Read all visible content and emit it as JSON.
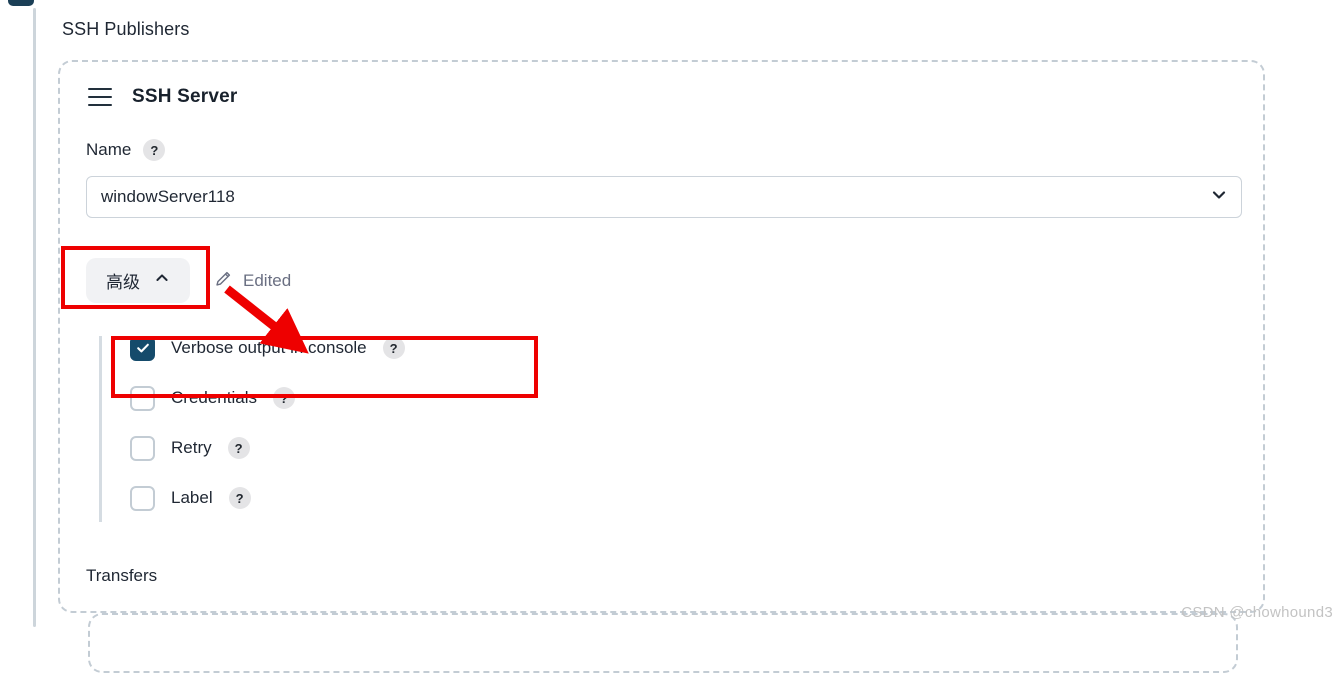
{
  "page": {
    "section_title": "SSH Publishers",
    "watermark": "CSDN @chowhound3"
  },
  "panel": {
    "title": "SSH Server",
    "drag_handle_icon": "hamburger-drag-icon",
    "name_field": {
      "label": "Name",
      "help": "?",
      "value": "windowServer118",
      "dropdown_icon": "chevron-down-icon"
    },
    "advanced": {
      "button_label": "高级",
      "button_icon": "chevron-up-icon",
      "status_label": "Edited",
      "status_icon": "pencil-icon"
    },
    "options": [
      {
        "label": "Verbose output in console",
        "checked": true,
        "help": "?"
      },
      {
        "label": "Credentials",
        "checked": false,
        "help": "?"
      },
      {
        "label": "Retry",
        "checked": false,
        "help": "?"
      },
      {
        "label": "Label",
        "checked": false,
        "help": "?"
      }
    ],
    "transfers_label": "Transfers"
  },
  "annotations": {
    "accent_color": "#ee0000",
    "checkbox_checked_color": "#154b6b"
  }
}
